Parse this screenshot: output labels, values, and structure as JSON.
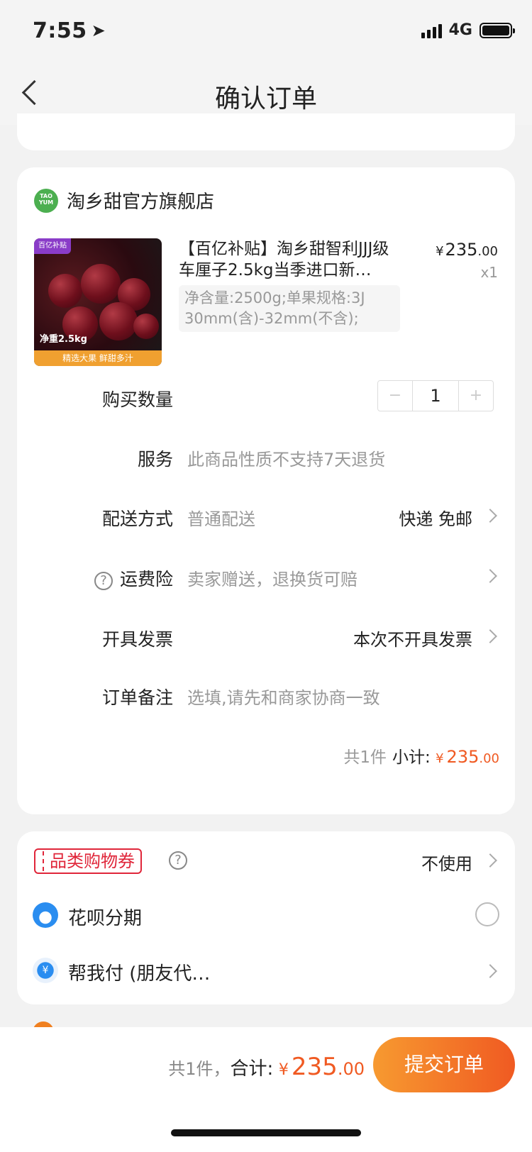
{
  "status_bar": {
    "time": "7:55",
    "network": "4G"
  },
  "nav": {
    "title": "确认订单"
  },
  "shop": {
    "logo_text": "TAO YUM",
    "name": "淘乡甜官方旗舰店"
  },
  "product": {
    "title": "【百亿补贴】淘乡甜智利JJJ级车厘子2.5kg当季进口新…",
    "image_tag": "百亿补贴",
    "image_weight": "净重2.5kg",
    "image_banner": "精选大果 鲜甜多汁",
    "price_yen": "¥",
    "price_int": "235",
    "price_dec": ".00",
    "qty": "x1",
    "sku": "净含量:2500g;单果规格:3J 30mm(含)-32mm(不含);"
  },
  "rows": {
    "quantity": {
      "label": "购买数量",
      "minus": "−",
      "value": "1",
      "plus": "+"
    },
    "service": {
      "label": "服务",
      "value": "此商品性质不支持7天退货"
    },
    "delivery": {
      "label": "配送方式",
      "value": "普通配送",
      "right": "快递 免邮"
    },
    "insurance": {
      "label": "运费险",
      "value": "卖家赠送，退换货可赔"
    },
    "invoice": {
      "label": "开具发票",
      "right": "本次不开具发票"
    },
    "note": {
      "label": "订单备注",
      "placeholder": "选填,请先和商家协商一致"
    }
  },
  "subtotal": {
    "count": "共1件",
    "label": "小计:",
    "yen": "¥",
    "int": "235",
    "dec": ".00"
  },
  "payment": {
    "coupon_label": "品类购物券",
    "coupon_value": "不使用",
    "huabei_label": "花呗分期",
    "bangwo_label": "帮我付 (朋友代…",
    "bangwo_symbol": "¥"
  },
  "footer": {
    "count": "共1件，",
    "total_label": "合计:",
    "yen": "¥",
    "int": "235",
    "dec": ".00",
    "submit": "提交订单"
  },
  "colors": {
    "accent": "#f05a22",
    "coupon": "#e0263a",
    "button_start": "#f79a30"
  }
}
